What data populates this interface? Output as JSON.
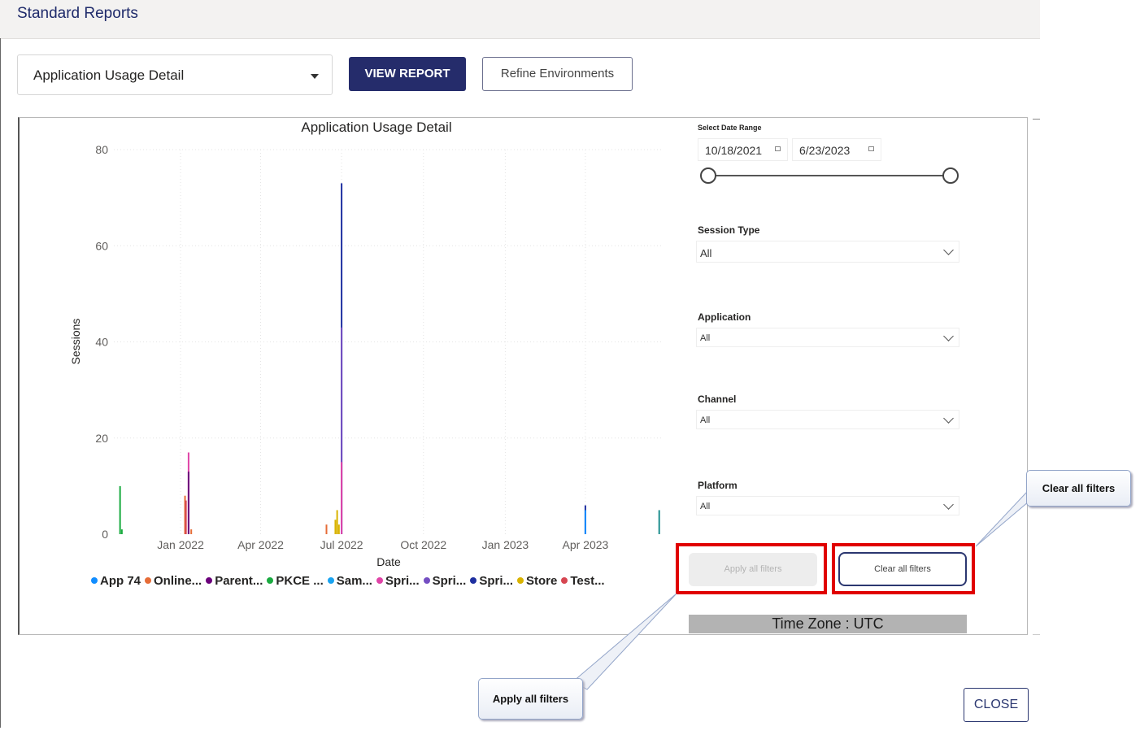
{
  "header": {
    "title": "Standard Reports"
  },
  "toolbar": {
    "report_select_value": "Application Usage Detail",
    "view_report_label": "VIEW REPORT",
    "refine_label": "Refine Environments"
  },
  "chart_data": {
    "type": "bar",
    "title": "Application Usage Detail",
    "xlabel": "Date",
    "ylabel": "Sessions",
    "ylim": [
      0,
      80
    ],
    "yticks": [
      0,
      20,
      40,
      60,
      80
    ],
    "xticks": [
      "Jan 2022",
      "Apr 2022",
      "Jul 2022",
      "Oct 2022",
      "Jan 2023",
      "Apr 2023"
    ],
    "grid": true,
    "legend_position": "bottom",
    "series": [
      {
        "name": "App 74",
        "color": "#118DFF"
      },
      {
        "name": "Online...",
        "color": "#E66C37"
      },
      {
        "name": "Parent...",
        "color": "#6B007B"
      },
      {
        "name": "PKCE ...",
        "color": "#1AAB40"
      },
      {
        "name": "Sam...",
        "color": "#1AA3F0"
      },
      {
        "name": "Spri...",
        "color": "#E044A7"
      },
      {
        "name": "Spri...",
        "color": "#744EC2"
      },
      {
        "name": "Spri...",
        "color": "#1E2FA0"
      },
      {
        "name": "Store",
        "color": "#D9B300"
      },
      {
        "name": "Test...",
        "color": "#D64550"
      }
    ],
    "bars": [
      {
        "date": "2021-10-25",
        "value": 10,
        "color": "#1AAB40"
      },
      {
        "date": "2021-10-27",
        "value": 1,
        "color": "#1AAB40"
      },
      {
        "date": "2022-01-06",
        "value": 8,
        "color": "#E66C37"
      },
      {
        "date": "2022-01-07",
        "value": 7,
        "color": "#D64550"
      },
      {
        "date": "2022-01-10",
        "value": 17,
        "color": "#E044A7"
      },
      {
        "date": "2022-01-10",
        "value": 13,
        "color": "#6B007B"
      },
      {
        "date": "2022-01-13",
        "value": 1,
        "color": "#E66C37"
      },
      {
        "date": "2022-06-14",
        "value": 2,
        "color": "#E66C37"
      },
      {
        "date": "2022-06-24",
        "value": 3,
        "color": "#D9B300"
      },
      {
        "date": "2022-06-26",
        "value": 5,
        "color": "#D9B300"
      },
      {
        "date": "2022-06-28",
        "value": 2,
        "color": "#D9B300"
      },
      {
        "date": "2022-07-01",
        "value": 73,
        "color": "#1E2FA0"
      },
      {
        "date": "2022-07-01",
        "value": 43,
        "color": "#744EC2"
      },
      {
        "date": "2022-07-01",
        "value": 15,
        "color": "#E044A7"
      },
      {
        "date": "2023-04-01",
        "value": 6,
        "color": "#1E2FA0"
      },
      {
        "date": "2023-04-01",
        "value": 5,
        "color": "#118DFF"
      },
      {
        "date": "2023-06-23",
        "value": 5,
        "color": "#1F8F8F"
      }
    ]
  },
  "filters": {
    "date_range_label": "Select Date Range",
    "date_start": "10/18/2021",
    "date_end": "6/23/2023",
    "session_type_label": "Session Type",
    "session_type_value": "All",
    "application_label": "Application",
    "application_value": "All",
    "channel_label": "Channel",
    "channel_value": "All",
    "platform_label": "Platform",
    "platform_value": "All",
    "apply_label": "Apply all filters",
    "clear_label": "Clear all filters",
    "timezone": "Time Zone : UTC"
  },
  "callouts": {
    "clear": "Clear all filters",
    "apply": "Apply all filters"
  },
  "footer": {
    "close_label": "CLOSE"
  }
}
